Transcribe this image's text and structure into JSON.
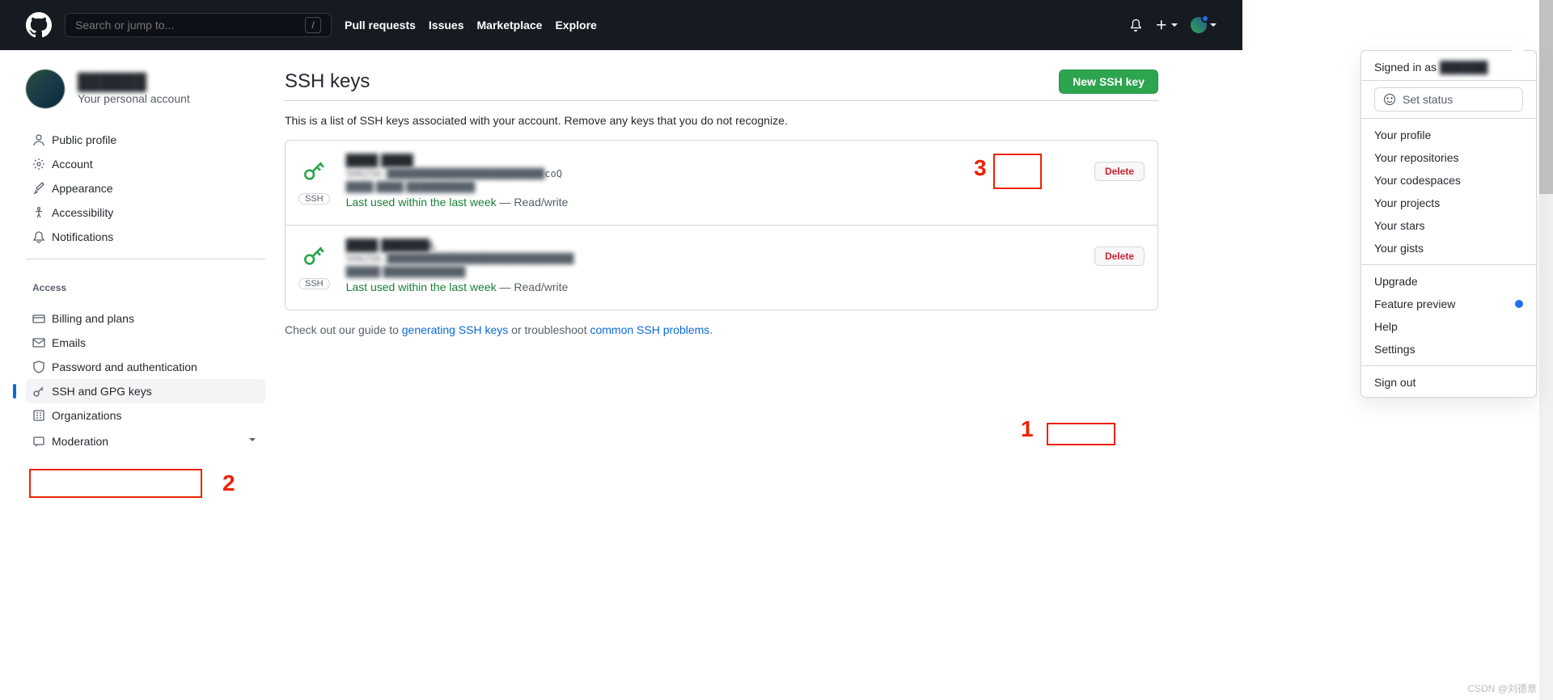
{
  "header": {
    "search_placeholder": "Search or jump to...",
    "nav": {
      "pulls": "Pull requests",
      "issues": "Issues",
      "marketplace": "Marketplace",
      "explore": "Explore"
    }
  },
  "profile": {
    "username": "██████",
    "subtitle": "Your personal account"
  },
  "sidebar": {
    "items": [
      {
        "label": "Public profile"
      },
      {
        "label": "Account"
      },
      {
        "label": "Appearance"
      },
      {
        "label": "Accessibility"
      },
      {
        "label": "Notifications"
      }
    ],
    "access_heading": "Access",
    "access_items": [
      {
        "label": "Billing and plans"
      },
      {
        "label": "Emails"
      },
      {
        "label": "Password and authentication"
      },
      {
        "label": "SSH and GPG keys"
      },
      {
        "label": "Organizations"
      },
      {
        "label": "Moderation"
      }
    ]
  },
  "main": {
    "title": "SSH keys",
    "new_button": "New SSH key",
    "description": "This is a list of SSH keys associated with your account. Remove any keys that you do not recognize.",
    "keys": [
      {
        "name": "████ ████",
        "fingerprint": "SHA256:███████████████████████████",
        "fp_suffix": "coQ",
        "added": "████ ████ ██████████",
        "last_used": "Last used within the last week",
        "rw": " — Read/write",
        "badge": "SSH",
        "delete": "Delete"
      },
      {
        "name": "████ ██████L",
        "fingerprint": "SHA256:████████████████████████████████",
        "fp_suffix": "",
        "added": "█████ ████████████",
        "last_used": "Last used within the last week",
        "rw": " — Read/write",
        "badge": "SSH",
        "delete": "Delete"
      }
    ],
    "footer_pre": "Check out our guide to ",
    "footer_link1": "generating SSH keys",
    "footer_mid": " or troubleshoot ",
    "footer_link2": "common SSH problems",
    "footer_post": "."
  },
  "dropdown": {
    "signed_in": "Signed in as ",
    "user": "██████",
    "set_status": "Set status",
    "items1": [
      "Your profile",
      "Your repositories",
      "Your codespaces",
      "Your projects",
      "Your stars",
      "Your gists"
    ],
    "items2": [
      "Upgrade",
      "Feature preview",
      "Help",
      "Settings"
    ],
    "signout": "Sign out"
  },
  "annotations": {
    "a1": "1",
    "a2": "2",
    "a3": "3"
  },
  "watermark": "CSDN @刘德意"
}
